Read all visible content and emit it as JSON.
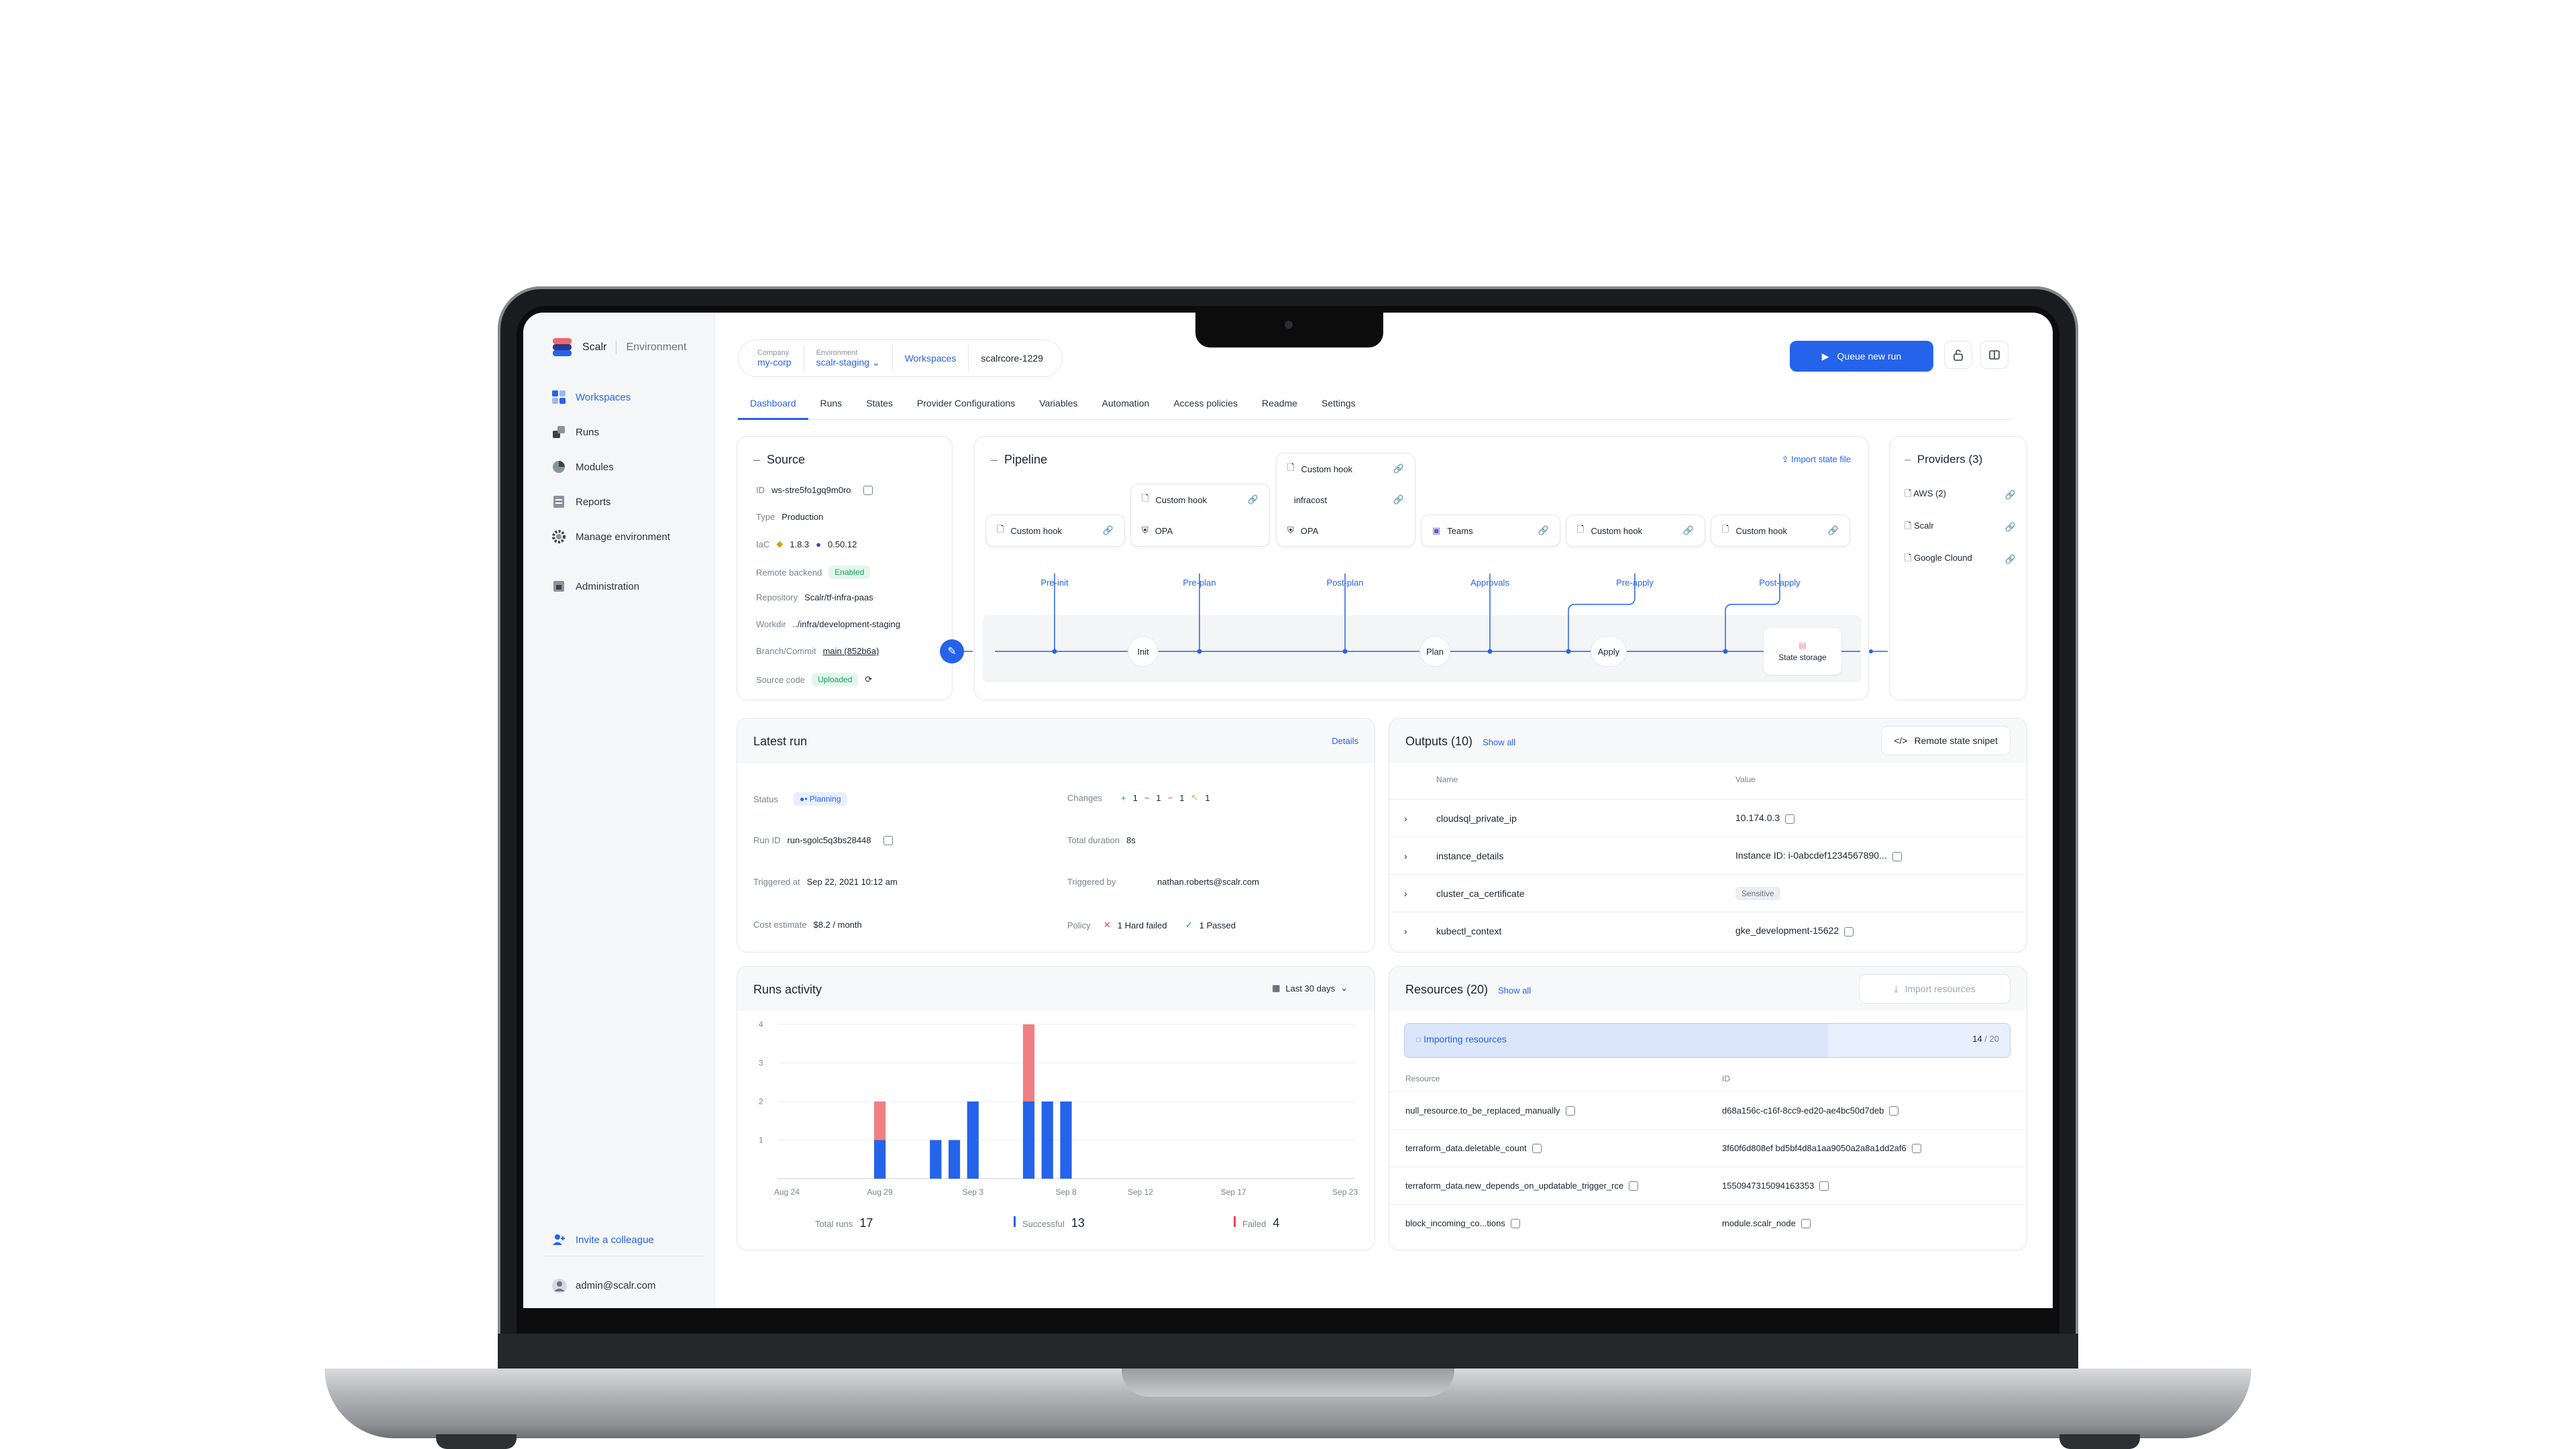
{
  "app": {
    "name": "Scalr",
    "section": "Environment"
  },
  "sidebar": {
    "items": [
      {
        "label": "Workspaces",
        "icon": "workspaces-icon",
        "active": true
      },
      {
        "label": "Runs",
        "icon": "runs-icon"
      },
      {
        "label": "Modules",
        "icon": "modules-icon"
      },
      {
        "label": "Reports",
        "icon": "reports-icon"
      },
      {
        "label": "Manage environment",
        "icon": "gear-icon"
      },
      {
        "label": "Administration",
        "icon": "admin-icon"
      }
    ],
    "invite": "Invite a colleague",
    "user": "admin@scalr.com"
  },
  "breadcrumb": {
    "company_label": "Company",
    "company": "my-corp",
    "env_label": "Environment",
    "env": "scalr-staging",
    "workspaces": "Workspaces",
    "workspace": "scalrcore-1229"
  },
  "header": {
    "queue": "Queue new run"
  },
  "tabs": [
    "Dashboard",
    "Runs",
    "States",
    "Provider Configurations",
    "Variables",
    "Automation",
    "Access policies",
    "Readme",
    "Settings"
  ],
  "source": {
    "title": "Source",
    "id_k": "ID",
    "id": "ws-stre5fo1gq9m0ro",
    "type_k": "Type",
    "type": "Production",
    "iac_k": "IaC",
    "iac_v1": "1.8.3",
    "iac_v2": "0.50.12",
    "remote_k": "Remote backend",
    "remote": "Enabled",
    "repo_k": "Repository",
    "repo": "Scalr/tf-infra-paas",
    "workdir_k": "Workdir",
    "workdir": "../infra/development-staging",
    "branch_k": "Branch/Commit",
    "branch": "main (852b6a)",
    "code_k": "Source code",
    "code": "Uploaded"
  },
  "pipeline": {
    "title": "Pipeline",
    "import": "Import state file",
    "hook": "Custom hook",
    "opa": "OPA",
    "infracost": "infracost",
    "teams": "Teams",
    "stages": [
      "Pre-init",
      "Pre-plan",
      "Post-plan",
      "Approvals",
      "Pre-apply",
      "Post-apply"
    ],
    "gates": [
      "Init",
      "Plan",
      "Apply"
    ],
    "storage": "State storage"
  },
  "providers": {
    "title": "Providers (3)",
    "items": [
      "AWS (2)",
      "Scalr",
      "Google Clound"
    ]
  },
  "latest": {
    "title": "Latest run",
    "details": "Details",
    "status_k": "Status",
    "status": "Planning",
    "changes_k": "Changes",
    "c_add": "1",
    "c_upd": "1",
    "c_del": "1",
    "c_rep": "1",
    "runid_k": "Run ID",
    "runid": "run-sgolc5q3bs28448",
    "dur_k": "Total duration",
    "dur": "8s",
    "trig_k": "Triggered at",
    "trig": "Sep 22, 2021  10:12 am",
    "trigby_k": "Triggered by",
    "trigby": "nathan.roberts@scalr.com",
    "cost_k": "Cost estimate",
    "cost": "$8.2 / month",
    "policy_k": "Policy",
    "policy_fail": "1 Hard failed",
    "policy_pass": "1 Passed"
  },
  "outputs": {
    "title": "Outputs (10)",
    "show_all": "Show all",
    "snippet": "Remote state snipet",
    "col_name": "Name",
    "col_value": "Value",
    "rows": [
      {
        "name": "cloudsql_private_ip",
        "value": "10.174.0.3"
      },
      {
        "name": "instance_details",
        "value": "Instance ID: i-0abcdef1234567890..."
      },
      {
        "name": "cluster_ca_certificate",
        "value": "Sensitive"
      },
      {
        "name": "kubectl_context",
        "value": "gke_development-15622"
      }
    ]
  },
  "activity": {
    "title": "Runs activity",
    "range": "Last 30 days",
    "total_k": "Total runs",
    "total": "17",
    "success_k": "Successful",
    "success": "13",
    "failed_k": "Failed",
    "failed": "4",
    "colors": {
      "success": "#2563eb",
      "failed": "#f07f82"
    }
  },
  "resources": {
    "title": "Resources (20)",
    "show_all": "Show all",
    "import": "Import resources",
    "importing": "Importing resources",
    "progress_done": "14",
    "progress_total": "/ 20",
    "progress": 0.7,
    "col_res": "Resource",
    "col_id": "ID",
    "rows": [
      {
        "name": "null_resource.to_be_replaced_manually",
        "id": "d68a156c-c16f-8cc9-ed20-ae4bc50d7deb"
      },
      {
        "name": "terraform_data.deletable_count",
        "id": "3f60f6d808ef bd5bf4d8a1aa9050a2a8a1dd2af6"
      },
      {
        "name": "terraform_data.new_depends_on_updatable_trigger_rce",
        "id": "1550947315094163353"
      },
      {
        "name": "block_incoming_co...tions",
        "id": "module.scalr_node"
      }
    ]
  },
  "chart_data": {
    "type": "bar",
    "title": "Runs activity",
    "stacked": true,
    "x": [
      "Aug 24",
      "Aug 25",
      "Aug 26",
      "Aug 27",
      "Aug 28",
      "Aug 29",
      "Aug 30",
      "Aug 31",
      "Sep 1",
      "Sep 2",
      "Sep 3",
      "Sep 4",
      "Sep 5",
      "Sep 6",
      "Sep 7",
      "Sep 8",
      "Sep 9",
      "Sep 10",
      "Sep 11",
      "Sep 12",
      "Sep 13",
      "Sep 14",
      "Sep 15",
      "Sep 16",
      "Sep 17",
      "Sep 18",
      "Sep 19",
      "Sep 20",
      "Sep 21",
      "Sep 22",
      "Sep 23"
    ],
    "xticks": [
      "Aug 24",
      "Aug 29",
      "Sep 3",
      "Sep 8",
      "Sep 12",
      "Sep 17",
      "Sep 23"
    ],
    "yticks": [
      "1",
      "2",
      "3",
      "4"
    ],
    "ylim": [
      0,
      4
    ],
    "series": [
      {
        "name": "Successful",
        "values": [
          0,
          0,
          0,
          0,
          0,
          1,
          0,
          0,
          1,
          1,
          2,
          0,
          0,
          2,
          2,
          2,
          0,
          0,
          0,
          0,
          0,
          0,
          0,
          0,
          0,
          0,
          0,
          0,
          0,
          0,
          0
        ]
      },
      {
        "name": "Failed",
        "values": [
          0,
          0,
          0,
          0,
          0,
          1,
          0,
          0,
          0,
          0,
          0,
          0,
          0,
          2,
          0,
          0,
          0,
          0,
          0,
          0,
          0,
          0,
          0,
          0,
          0,
          0,
          0,
          0,
          0,
          0,
          0
        ]
      }
    ]
  }
}
